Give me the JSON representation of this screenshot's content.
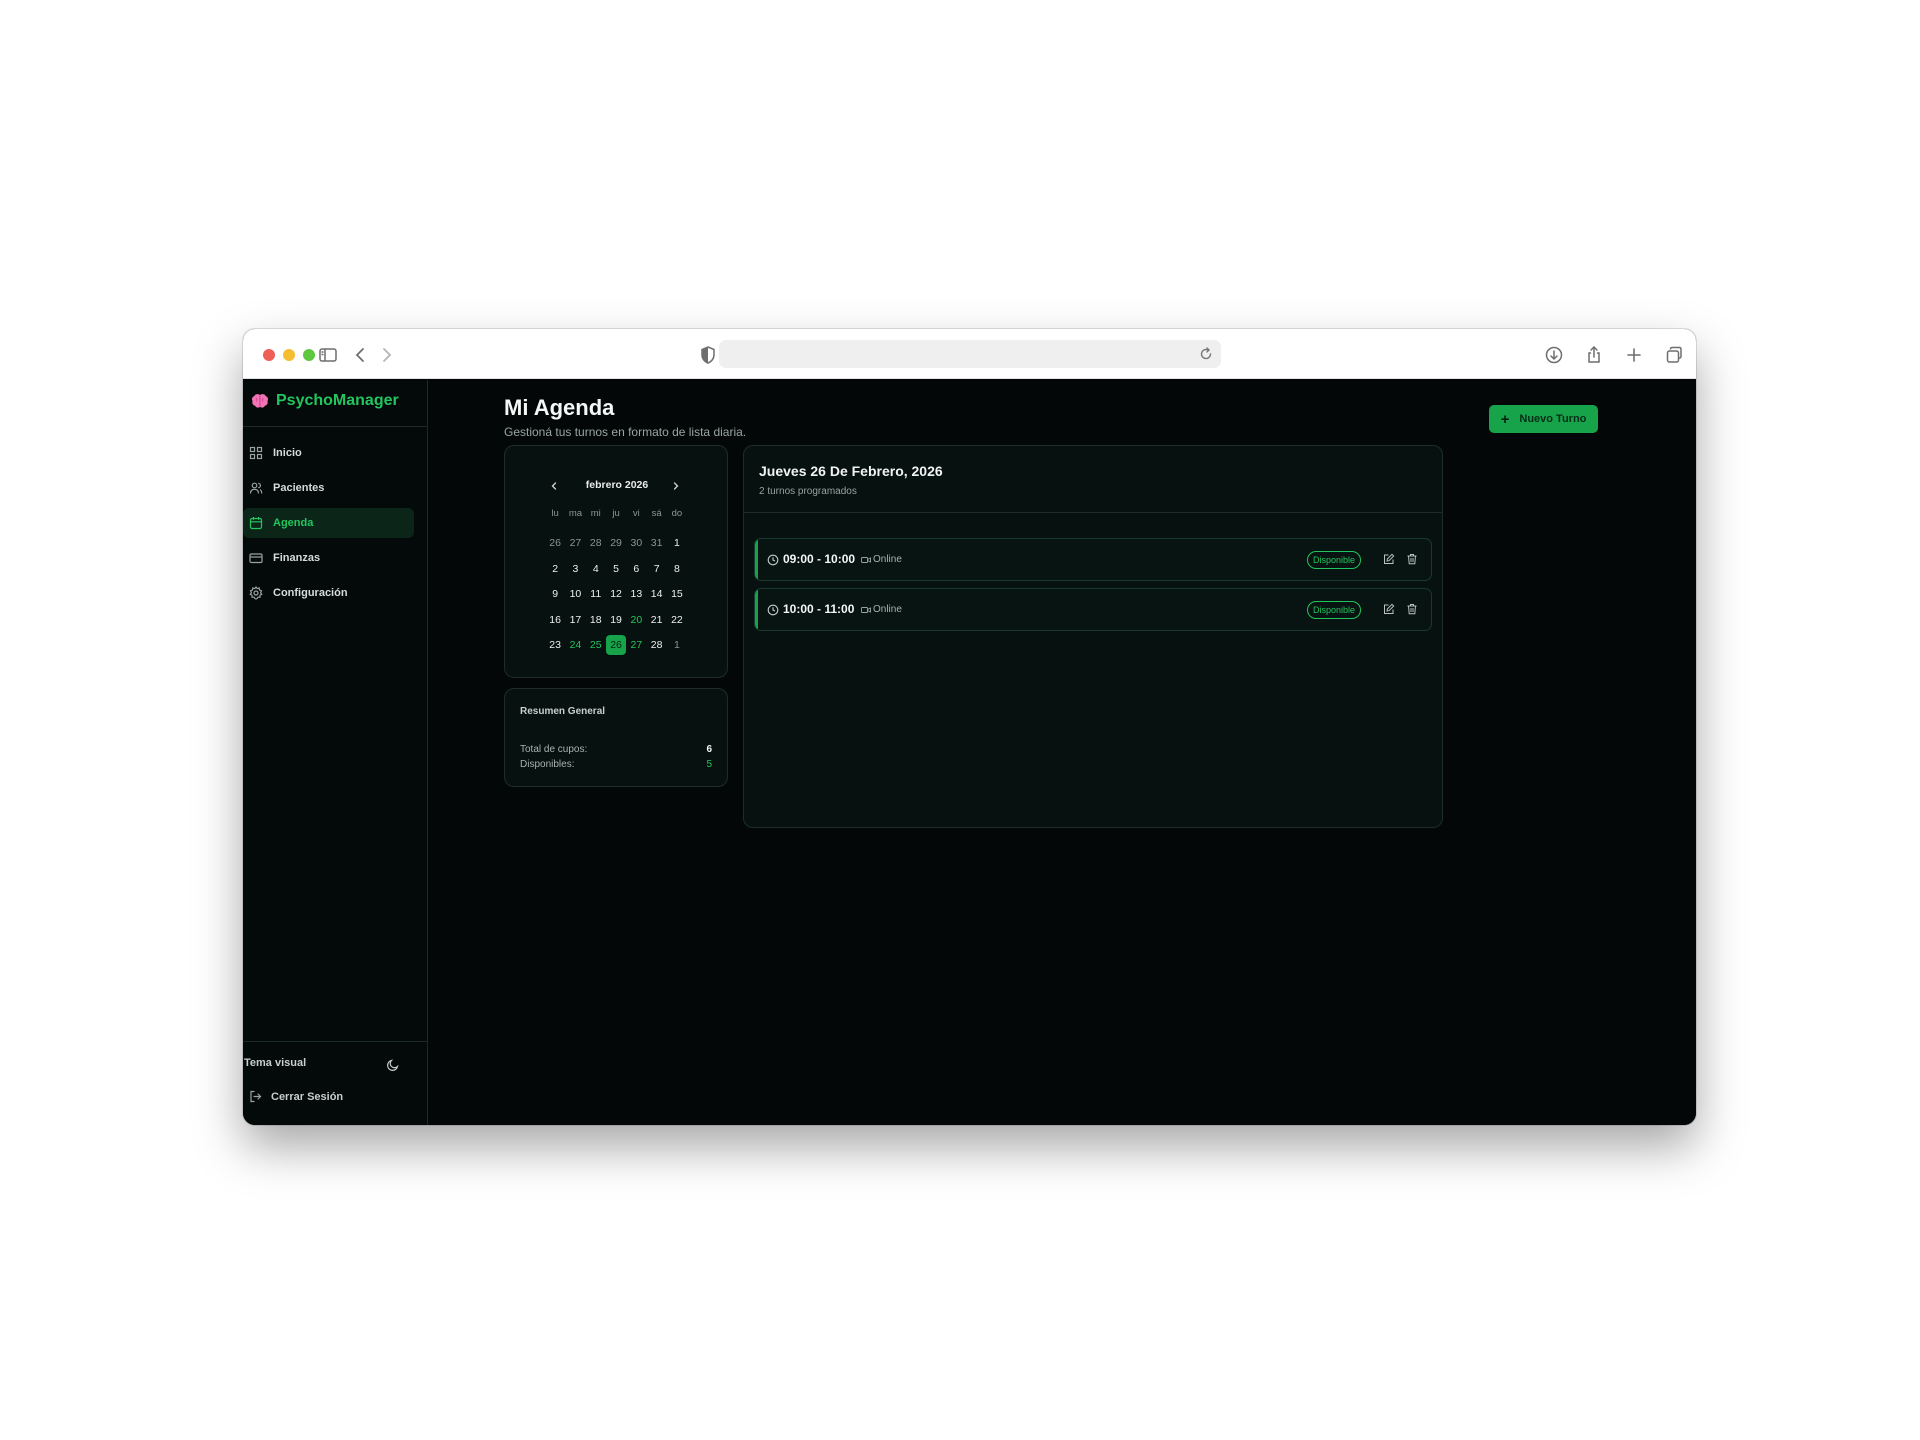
{
  "sidebar": {
    "brand": "PsychoManager",
    "items": [
      {
        "label": "Inicio",
        "icon": "dashboard-icon"
      },
      {
        "label": "Pacientes",
        "icon": "users-icon"
      },
      {
        "label": "Agenda",
        "icon": "calendar-icon",
        "active": true
      },
      {
        "label": "Finanzas",
        "icon": "credit-card-icon"
      },
      {
        "label": "Configuración",
        "icon": "gear-icon"
      }
    ],
    "theme_label": "Tema visual",
    "logout_label": "Cerrar Sesión"
  },
  "header": {
    "title": "Mi Agenda",
    "subtitle": "Gestioná tus turnos en formato de lista diaria.",
    "new_button": "Nuevo Turno",
    "new_button_icon": "+"
  },
  "calendar": {
    "month_label": "febrero 2026",
    "weekdays": [
      "lu",
      "ma",
      "mi",
      "ju",
      "vi",
      "sá",
      "do"
    ],
    "days": [
      {
        "n": "26",
        "s": "muted"
      },
      {
        "n": "27",
        "s": "muted"
      },
      {
        "n": "28",
        "s": "muted"
      },
      {
        "n": "29",
        "s": "muted"
      },
      {
        "n": "30",
        "s": "muted"
      },
      {
        "n": "31",
        "s": "muted"
      },
      {
        "n": "1",
        "s": "normal"
      },
      {
        "n": "2",
        "s": "normal"
      },
      {
        "n": "3",
        "s": "normal"
      },
      {
        "n": "4",
        "s": "normal"
      },
      {
        "n": "5",
        "s": "normal"
      },
      {
        "n": "6",
        "s": "normal"
      },
      {
        "n": "7",
        "s": "normal"
      },
      {
        "n": "8",
        "s": "normal"
      },
      {
        "n": "9",
        "s": "normal"
      },
      {
        "n": "10",
        "s": "normal"
      },
      {
        "n": "11",
        "s": "normal"
      },
      {
        "n": "12",
        "s": "normal"
      },
      {
        "n": "13",
        "s": "normal"
      },
      {
        "n": "14",
        "s": "normal"
      },
      {
        "n": "15",
        "s": "normal"
      },
      {
        "n": "16",
        "s": "normal"
      },
      {
        "n": "17",
        "s": "normal"
      },
      {
        "n": "18",
        "s": "normal"
      },
      {
        "n": "19",
        "s": "normal"
      },
      {
        "n": "20",
        "s": "avail"
      },
      {
        "n": "21",
        "s": "normal"
      },
      {
        "n": "22",
        "s": "normal"
      },
      {
        "n": "23",
        "s": "normal"
      },
      {
        "n": "24",
        "s": "avail"
      },
      {
        "n": "25",
        "s": "avail"
      },
      {
        "n": "26",
        "s": "selected"
      },
      {
        "n": "27",
        "s": "avail"
      },
      {
        "n": "28",
        "s": "normal"
      },
      {
        "n": "1",
        "s": "muted"
      }
    ]
  },
  "summary": {
    "title": "Resumen General",
    "total_label": "Total de cupos:",
    "total_value": "6",
    "available_label": "Disponibles:",
    "available_value": "5"
  },
  "day_view": {
    "title": "Jueves 26 De Febrero, 2026",
    "subtitle": "2 turnos programados",
    "slots": [
      {
        "time": "09:00 - 10:00",
        "mode": "Online",
        "status": "Disponible"
      },
      {
        "time": "10:00 - 11:00",
        "mode": "Online",
        "status": "Disponible"
      }
    ]
  },
  "colors": {
    "accent": "#22c55e",
    "button": "#16a34a",
    "background": "#030707",
    "card": "#07110f"
  }
}
